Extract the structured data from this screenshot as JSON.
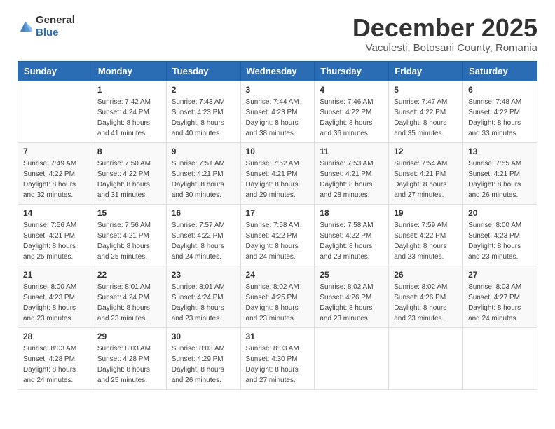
{
  "logo": {
    "text_general": "General",
    "text_blue": "Blue"
  },
  "header": {
    "month_title": "December 2025",
    "subtitle": "Vaculesti, Botosani County, Romania"
  },
  "days_of_week": [
    "Sunday",
    "Monday",
    "Tuesday",
    "Wednesday",
    "Thursday",
    "Friday",
    "Saturday"
  ],
  "weeks": [
    [
      {
        "day": "",
        "sunrise": "",
        "sunset": "",
        "daylight": ""
      },
      {
        "day": "1",
        "sunrise": "Sunrise: 7:42 AM",
        "sunset": "Sunset: 4:24 PM",
        "daylight": "Daylight: 8 hours and 41 minutes."
      },
      {
        "day": "2",
        "sunrise": "Sunrise: 7:43 AM",
        "sunset": "Sunset: 4:23 PM",
        "daylight": "Daylight: 8 hours and 40 minutes."
      },
      {
        "day": "3",
        "sunrise": "Sunrise: 7:44 AM",
        "sunset": "Sunset: 4:23 PM",
        "daylight": "Daylight: 8 hours and 38 minutes."
      },
      {
        "day": "4",
        "sunrise": "Sunrise: 7:46 AM",
        "sunset": "Sunset: 4:22 PM",
        "daylight": "Daylight: 8 hours and 36 minutes."
      },
      {
        "day": "5",
        "sunrise": "Sunrise: 7:47 AM",
        "sunset": "Sunset: 4:22 PM",
        "daylight": "Daylight: 8 hours and 35 minutes."
      },
      {
        "day": "6",
        "sunrise": "Sunrise: 7:48 AM",
        "sunset": "Sunset: 4:22 PM",
        "daylight": "Daylight: 8 hours and 33 minutes."
      }
    ],
    [
      {
        "day": "7",
        "sunrise": "Sunrise: 7:49 AM",
        "sunset": "Sunset: 4:22 PM",
        "daylight": "Daylight: 8 hours and 32 minutes."
      },
      {
        "day": "8",
        "sunrise": "Sunrise: 7:50 AM",
        "sunset": "Sunset: 4:22 PM",
        "daylight": "Daylight: 8 hours and 31 minutes."
      },
      {
        "day": "9",
        "sunrise": "Sunrise: 7:51 AM",
        "sunset": "Sunset: 4:21 PM",
        "daylight": "Daylight: 8 hours and 30 minutes."
      },
      {
        "day": "10",
        "sunrise": "Sunrise: 7:52 AM",
        "sunset": "Sunset: 4:21 PM",
        "daylight": "Daylight: 8 hours and 29 minutes."
      },
      {
        "day": "11",
        "sunrise": "Sunrise: 7:53 AM",
        "sunset": "Sunset: 4:21 PM",
        "daylight": "Daylight: 8 hours and 28 minutes."
      },
      {
        "day": "12",
        "sunrise": "Sunrise: 7:54 AM",
        "sunset": "Sunset: 4:21 PM",
        "daylight": "Daylight: 8 hours and 27 minutes."
      },
      {
        "day": "13",
        "sunrise": "Sunrise: 7:55 AM",
        "sunset": "Sunset: 4:21 PM",
        "daylight": "Daylight: 8 hours and 26 minutes."
      }
    ],
    [
      {
        "day": "14",
        "sunrise": "Sunrise: 7:56 AM",
        "sunset": "Sunset: 4:21 PM",
        "daylight": "Daylight: 8 hours and 25 minutes."
      },
      {
        "day": "15",
        "sunrise": "Sunrise: 7:56 AM",
        "sunset": "Sunset: 4:21 PM",
        "daylight": "Daylight: 8 hours and 25 minutes."
      },
      {
        "day": "16",
        "sunrise": "Sunrise: 7:57 AM",
        "sunset": "Sunset: 4:22 PM",
        "daylight": "Daylight: 8 hours and 24 minutes."
      },
      {
        "day": "17",
        "sunrise": "Sunrise: 7:58 AM",
        "sunset": "Sunset: 4:22 PM",
        "daylight": "Daylight: 8 hours and 24 minutes."
      },
      {
        "day": "18",
        "sunrise": "Sunrise: 7:58 AM",
        "sunset": "Sunset: 4:22 PM",
        "daylight": "Daylight: 8 hours and 23 minutes."
      },
      {
        "day": "19",
        "sunrise": "Sunrise: 7:59 AM",
        "sunset": "Sunset: 4:22 PM",
        "daylight": "Daylight: 8 hours and 23 minutes."
      },
      {
        "day": "20",
        "sunrise": "Sunrise: 8:00 AM",
        "sunset": "Sunset: 4:23 PM",
        "daylight": "Daylight: 8 hours and 23 minutes."
      }
    ],
    [
      {
        "day": "21",
        "sunrise": "Sunrise: 8:00 AM",
        "sunset": "Sunset: 4:23 PM",
        "daylight": "Daylight: 8 hours and 23 minutes."
      },
      {
        "day": "22",
        "sunrise": "Sunrise: 8:01 AM",
        "sunset": "Sunset: 4:24 PM",
        "daylight": "Daylight: 8 hours and 23 minutes."
      },
      {
        "day": "23",
        "sunrise": "Sunrise: 8:01 AM",
        "sunset": "Sunset: 4:24 PM",
        "daylight": "Daylight: 8 hours and 23 minutes."
      },
      {
        "day": "24",
        "sunrise": "Sunrise: 8:02 AM",
        "sunset": "Sunset: 4:25 PM",
        "daylight": "Daylight: 8 hours and 23 minutes."
      },
      {
        "day": "25",
        "sunrise": "Sunrise: 8:02 AM",
        "sunset": "Sunset: 4:26 PM",
        "daylight": "Daylight: 8 hours and 23 minutes."
      },
      {
        "day": "26",
        "sunrise": "Sunrise: 8:02 AM",
        "sunset": "Sunset: 4:26 PM",
        "daylight": "Daylight: 8 hours and 23 minutes."
      },
      {
        "day": "27",
        "sunrise": "Sunrise: 8:03 AM",
        "sunset": "Sunset: 4:27 PM",
        "daylight": "Daylight: 8 hours and 24 minutes."
      }
    ],
    [
      {
        "day": "28",
        "sunrise": "Sunrise: 8:03 AM",
        "sunset": "Sunset: 4:28 PM",
        "daylight": "Daylight: 8 hours and 24 minutes."
      },
      {
        "day": "29",
        "sunrise": "Sunrise: 8:03 AM",
        "sunset": "Sunset: 4:28 PM",
        "daylight": "Daylight: 8 hours and 25 minutes."
      },
      {
        "day": "30",
        "sunrise": "Sunrise: 8:03 AM",
        "sunset": "Sunset: 4:29 PM",
        "daylight": "Daylight: 8 hours and 26 minutes."
      },
      {
        "day": "31",
        "sunrise": "Sunrise: 8:03 AM",
        "sunset": "Sunset: 4:30 PM",
        "daylight": "Daylight: 8 hours and 27 minutes."
      },
      {
        "day": "",
        "sunrise": "",
        "sunset": "",
        "daylight": ""
      },
      {
        "day": "",
        "sunrise": "",
        "sunset": "",
        "daylight": ""
      },
      {
        "day": "",
        "sunrise": "",
        "sunset": "",
        "daylight": ""
      }
    ]
  ]
}
